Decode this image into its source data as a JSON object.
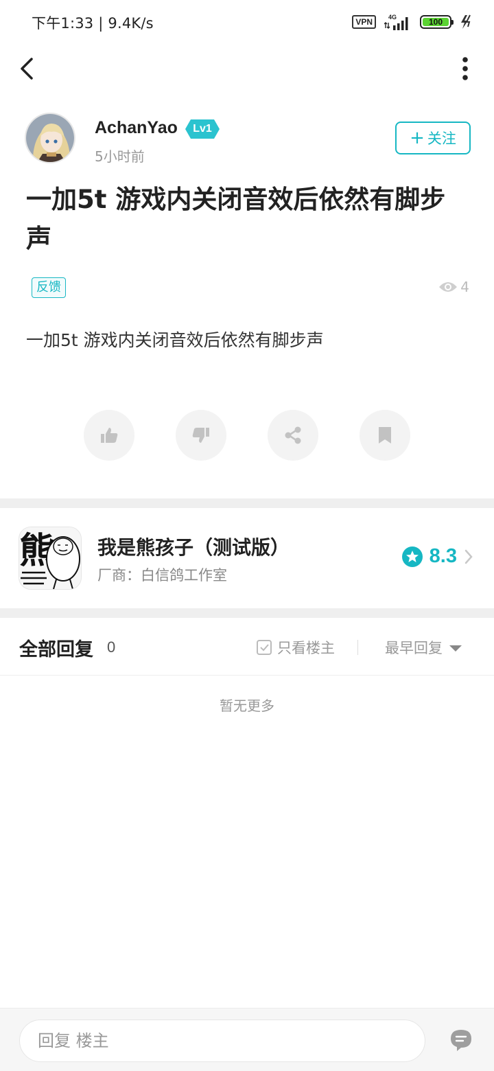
{
  "status_bar": {
    "time_speed": "下午1:33 | 9.4K/s",
    "vpn": "VPN",
    "network": "4G",
    "battery": "100"
  },
  "author": {
    "name": "AchanYao",
    "level": "Lv1",
    "time": "5小时前",
    "follow_label": "关注"
  },
  "post": {
    "title": "一加5t 游戏内关闭音效后依然有脚步声",
    "tag": "反馈",
    "views": "4",
    "body": "一加5t 游戏内关闭音效后依然有脚步声"
  },
  "actions": [
    {
      "icon": "thumbs-up-icon"
    },
    {
      "icon": "thumbs-down-icon"
    },
    {
      "icon": "share-icon"
    },
    {
      "icon": "bookmark-icon"
    }
  ],
  "game": {
    "icon_text": "熊",
    "name": "我是熊孩子（测试版）",
    "vendor": "厂商：白信鸽工作室",
    "rating": "8.3"
  },
  "replies": {
    "title": "全部回复",
    "count": "0",
    "only_op": "只看楼主",
    "sort": "最早回复",
    "empty": "暂无更多"
  },
  "bottom": {
    "placeholder": "回复  楼主"
  },
  "colors": {
    "accent": "#16b7c3",
    "battery": "#5bd332"
  }
}
